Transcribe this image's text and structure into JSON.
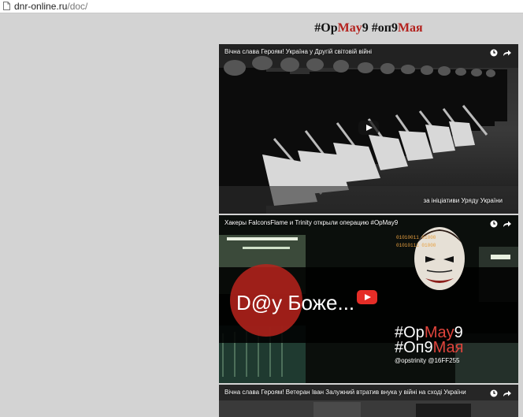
{
  "browser": {
    "url_domain": "dnr-online.ru",
    "url_path": "/doc/"
  },
  "heading": {
    "part1": "#Op",
    "part2": "May",
    "part3": "9 #оп9",
    "part4": "Мая"
  },
  "colors": {
    "page_bg": "#d3d3d3",
    "accent_red": "#b3221e",
    "youtube_red": "#e52d27"
  },
  "videos": [
    {
      "title": "Вічна слава Героям! Україна у Другій світовій війні",
      "caption": "за ініціативи Уряду України",
      "icons": [
        "clock-icon",
        "share-icon"
      ]
    },
    {
      "title": "Хакеры FalconsFlame и Trinity открыли операцию #OpMay9",
      "overlay_big": "D@у Боже...",
      "overlay_tag1_a": "#Op",
      "overlay_tag1_b": "May",
      "overlay_tag1_c": "9",
      "overlay_tag2_a": "#Оп9",
      "overlay_tag2_b": "Мая",
      "overlay_handles": "@opstrinity @16FF255",
      "binary_left": "01010011 01000",
      "binary_right": "01010111 01000",
      "icons": [
        "clock-icon",
        "share-icon"
      ]
    },
    {
      "title": "Вічна слава Героям! Ветеран Іван Залужний втратив внука у війні на сході України",
      "icons": [
        "clock-icon",
        "share-icon"
      ]
    }
  ]
}
